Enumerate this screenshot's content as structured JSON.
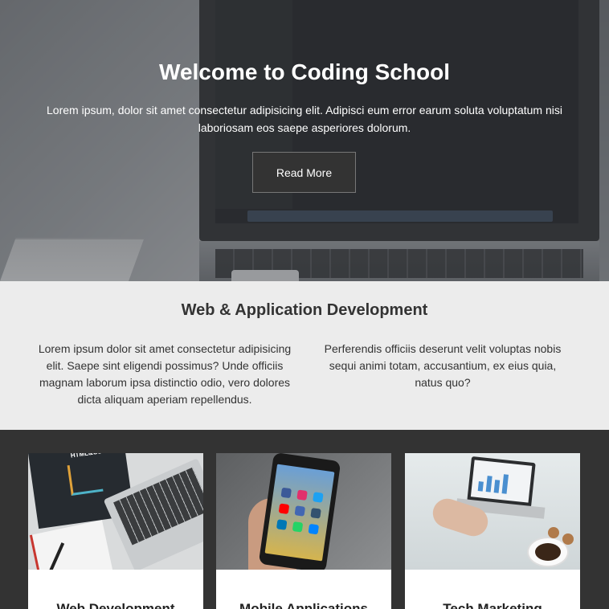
{
  "hero": {
    "title": "Welcome to Coding School",
    "text": "Lorem ipsum, dolor sit amet consectetur adipisicing elit. Adipisci eum error earum soluta voluptatum nisi laboriosam eos saepe asperiores dolorum.",
    "button_label": "Read More"
  },
  "about": {
    "title": "Web & Application Development",
    "left_text": "Lorem ipsum dolor sit amet consectetur adipisicing elit. Saepe sint eligendi possimus? Unde officiis magnam laborum ipsa distinctio odio, vero dolores dicta aliquam aperiam repellendus.",
    "right_text": "Perferendis officiis deserunt velit voluptas nobis sequi animi totam, accusantium, ex eius quia, natus quo?"
  },
  "cards": [
    {
      "title": "Web Development",
      "image": "html-css-book-laptop-image"
    },
    {
      "title": "Mobile Applications",
      "image": "smartphone-in-hand-image"
    },
    {
      "title": "Tech Marketing",
      "image": "laptop-analytics-coffee-image"
    }
  ],
  "colors": {
    "dark_background": "#333333",
    "light_section": "#ececec",
    "button_background": "#333333",
    "button_border": "#777777",
    "hero_text": "#ffffff"
  }
}
